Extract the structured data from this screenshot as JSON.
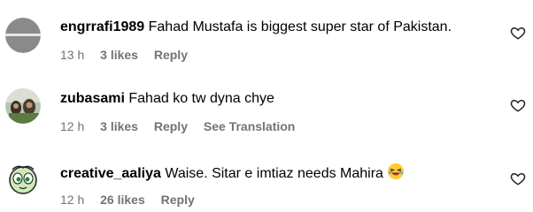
{
  "comments": [
    {
      "username": "engrrafi1989",
      "text": "Fahad Mustafa is biggest super star of Pakistan.",
      "time": "13 h",
      "likes": "3 likes",
      "reply": "Reply",
      "translation": ""
    },
    {
      "username": "zubasami",
      "text": "Fahad ko tw dyna chye",
      "time": "12 h",
      "likes": "3 likes",
      "reply": "Reply",
      "translation": "See Translation"
    },
    {
      "username": "creative_aaliya",
      "text": "Waise. Sitar e imtiaz needs Mahira",
      "emoji": "laughing-face-emoji",
      "time": "12 h",
      "likes": "26 likes",
      "reply": "Reply",
      "translation": ""
    }
  ],
  "icons": {
    "like": "heart-outline-icon"
  },
  "colors": {
    "meta_text": "#737373",
    "text": "#000000",
    "background": "#ffffff"
  }
}
